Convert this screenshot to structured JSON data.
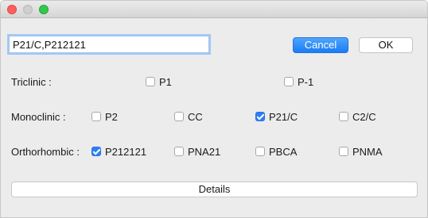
{
  "search": {
    "value": "P21/C,P212121"
  },
  "buttons": {
    "cancel": "Cancel",
    "ok": "OK",
    "details": "Details"
  },
  "rows": {
    "triclinic": {
      "label": "Triclinic :",
      "options": [
        {
          "label": "P1",
          "checked": false
        },
        {
          "label": "P-1",
          "checked": false
        }
      ]
    },
    "monoclinic": {
      "label": "Monoclinic :",
      "options": [
        {
          "label": "P2",
          "checked": false
        },
        {
          "label": "CC",
          "checked": false
        },
        {
          "label": "P21/C",
          "checked": true
        },
        {
          "label": "C2/C",
          "checked": false
        }
      ]
    },
    "orthorhombic": {
      "label": "Orthorhombic :",
      "options": [
        {
          "label": "P212121",
          "checked": true
        },
        {
          "label": "PNA21",
          "checked": false
        },
        {
          "label": "PBCA",
          "checked": false
        },
        {
          "label": "PNMA",
          "checked": false
        }
      ]
    }
  },
  "colors": {
    "accent": "#2d7ff6",
    "close": "#fc605c",
    "zoom": "#34c84a"
  }
}
